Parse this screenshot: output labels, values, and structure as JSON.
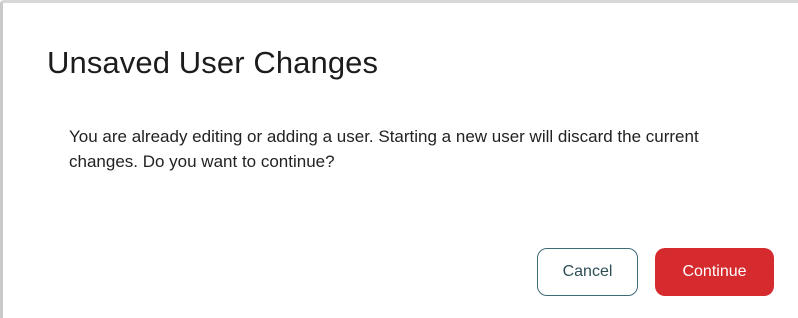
{
  "dialog": {
    "title": "Unsaved User Changes",
    "message": "You are already editing or adding a user. Starting a new user will discard the current changes. Do you want to continue?",
    "buttons": {
      "cancel_label": "Cancel",
      "continue_label": "Continue"
    }
  },
  "colors": {
    "primary_button": "#d52b2f",
    "secondary_button_border": "#3f6c76"
  }
}
